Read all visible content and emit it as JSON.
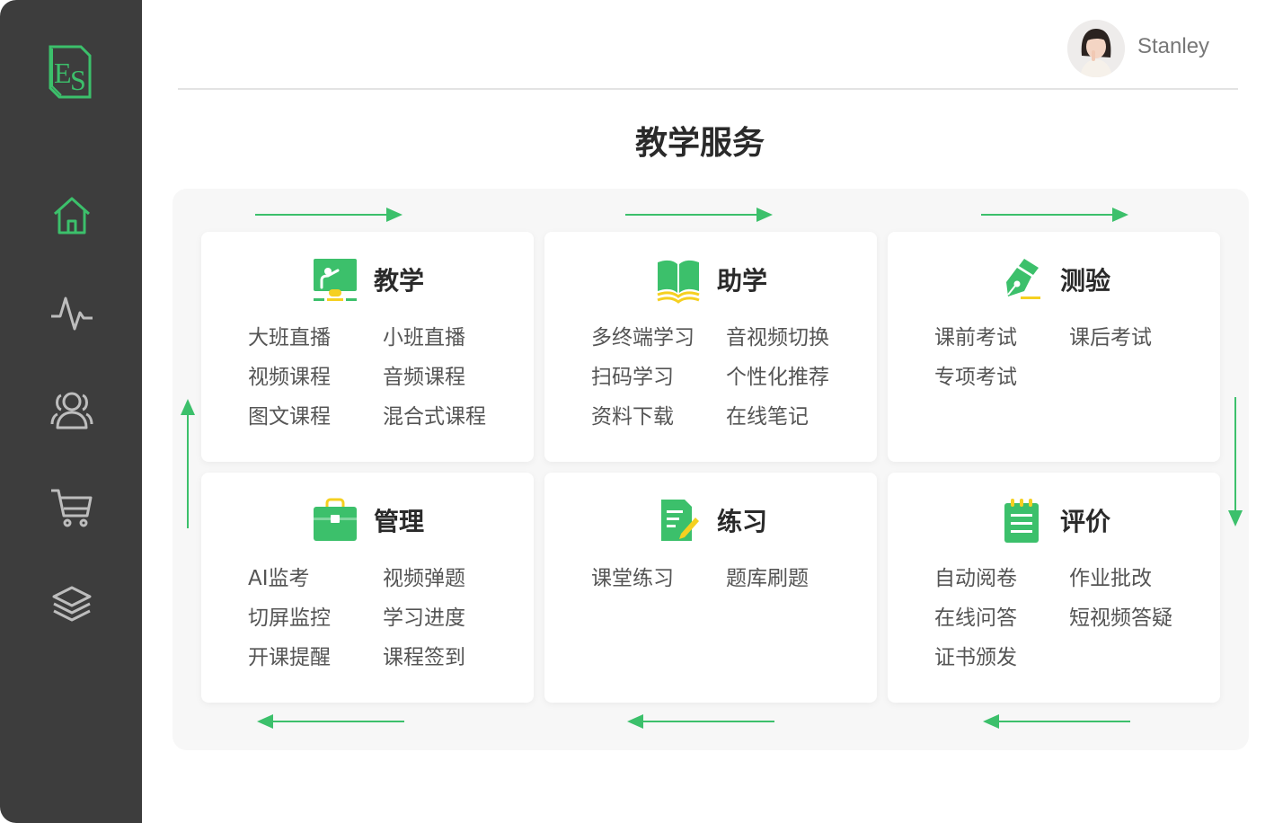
{
  "sidebar": {
    "logo": "ES",
    "nav": [
      {
        "icon": "home-icon"
      },
      {
        "icon": "activity-icon"
      },
      {
        "icon": "users-icon"
      },
      {
        "icon": "cart-icon"
      },
      {
        "icon": "layers-icon"
      }
    ]
  },
  "header": {
    "username": "Stanley"
  },
  "main": {
    "title": "教学服务",
    "cards": [
      {
        "title": "教学",
        "icon": "teaching-board-icon",
        "items": [
          "大班直播",
          "小班直播",
          "视频课程",
          "音频课程",
          "图文课程",
          "混合式课程"
        ]
      },
      {
        "title": "助学",
        "icon": "open-book-icon",
        "items": [
          "多终端学习",
          "音视频切换",
          "扫码学习",
          "个性化推荐",
          "资料下载",
          "在线笔记"
        ]
      },
      {
        "title": "测验",
        "icon": "pen-nib-icon",
        "items": [
          "课前考试",
          "课后考试",
          "专项考试"
        ]
      },
      {
        "title": "管理",
        "icon": "briefcase-icon",
        "items": [
          "AI监考",
          "视频弹题",
          "切屏监控",
          "学习进度",
          "开课提醒",
          "课程签到"
        ]
      },
      {
        "title": "练习",
        "icon": "edit-document-icon",
        "items": [
          "课堂练习",
          "题库刷题"
        ]
      },
      {
        "title": "评价",
        "icon": "notepad-icon",
        "items": [
          "自动阅卷",
          "作业批改",
          "在线问答",
          "短视频答疑",
          "证书颁发"
        ]
      }
    ]
  },
  "colors": {
    "accent": "#3cc06b",
    "accent_yellow": "#f5d020",
    "sidebar": "#3d3d3d"
  }
}
